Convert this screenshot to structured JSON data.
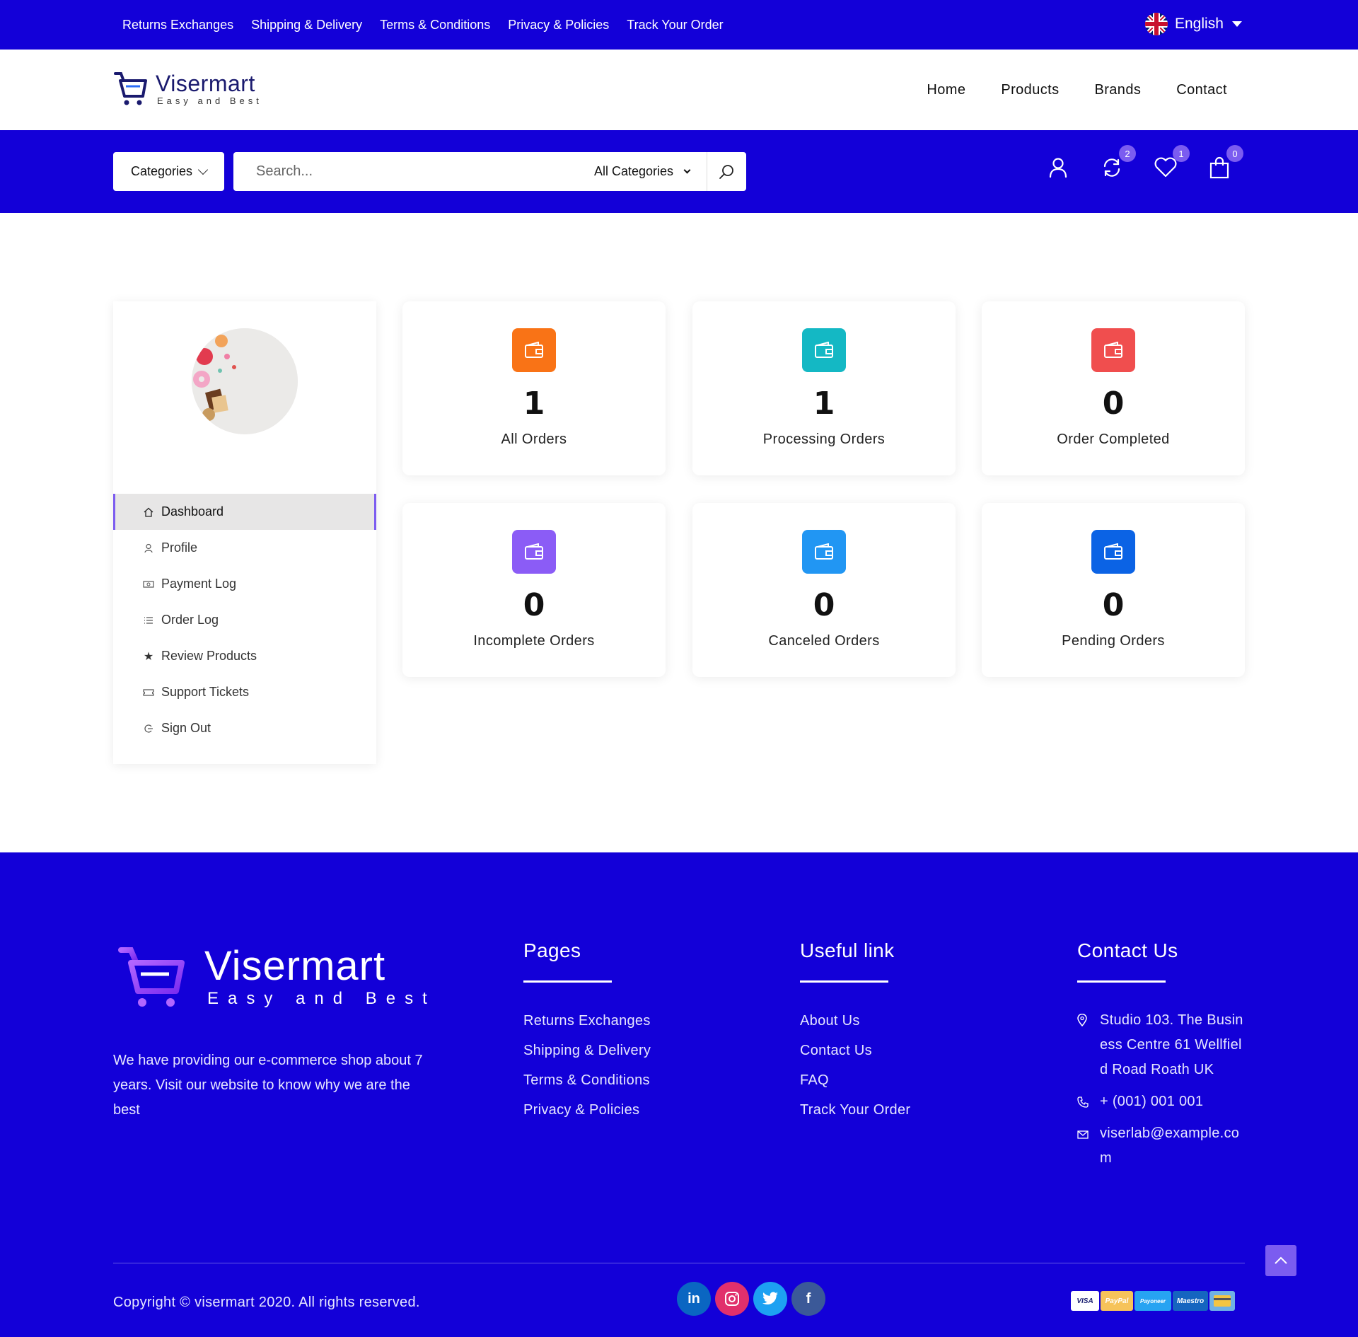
{
  "topbar": {
    "links": [
      "Returns Exchanges",
      "Shipping & Delivery",
      "Terms & Conditions",
      "Privacy & Policies",
      "Track Your Order"
    ],
    "language": "English"
  },
  "header": {
    "logo_brand": "Visermart",
    "logo_tagline": "Easy and Best",
    "nav": [
      "Home",
      "Products",
      "Brands",
      "Contact"
    ]
  },
  "search": {
    "categories_label": "Categories",
    "placeholder": "Search...",
    "all_categories": "All Categories",
    "badges": {
      "compare": "2",
      "wishlist": "1",
      "cart": "0"
    }
  },
  "sidebar": {
    "menu": [
      {
        "label": "Dashboard",
        "icon": "home-icon"
      },
      {
        "label": "Profile",
        "icon": "user-icon"
      },
      {
        "label": "Payment Log",
        "icon": "money-icon"
      },
      {
        "label": "Order Log",
        "icon": "list-icon"
      },
      {
        "label": "Review Products",
        "icon": "star-icon"
      },
      {
        "label": "Support Tickets",
        "icon": "ticket-icon"
      },
      {
        "label": "Sign Out",
        "icon": "signout-icon"
      }
    ]
  },
  "stats": [
    {
      "value": "1",
      "label": "All Orders",
      "color": "#f97316"
    },
    {
      "value": "1",
      "label": "Processing Orders",
      "color": "#14b8c4"
    },
    {
      "value": "0",
      "label": "Order Completed",
      "color": "#f04e4e"
    },
    {
      "value": "0",
      "label": "Incomplete Orders",
      "color": "#8b5cf6"
    },
    {
      "value": "0",
      "label": "Canceled Orders",
      "color": "#2196f3"
    },
    {
      "value": "0",
      "label": "Pending Orders",
      "color": "#0b63e5"
    }
  ],
  "footer": {
    "logo_brand": "Visermart",
    "logo_tagline": "Easy and Best",
    "about": "We have providing our e-commerce shop about 7 years. Visit our website to know why we are the best",
    "pages_title": "Pages",
    "pages": [
      "Returns Exchanges",
      "Shipping & Delivery",
      "Terms & Conditions",
      "Privacy & Policies"
    ],
    "useful_title": "Useful link",
    "useful": [
      "About Us",
      "Contact Us",
      "FAQ",
      "Track Your Order"
    ],
    "contact_title": "Contact Us",
    "address": "Studio 103. The Business Centre 61 Wellfield Road Roath UK",
    "phone": "+ (001) 001 001",
    "email": "viserlab@example.com",
    "copyright": "Copyright © visermart 2020. All rights reserved.",
    "social": [
      "in",
      "ig",
      "tw",
      "f"
    ],
    "payments": [
      "VISA",
      "PayPal",
      "Payoneer",
      "Maestro",
      "card"
    ]
  },
  "colors": {
    "primary": "#1300d8",
    "accent": "#7b5cf0"
  }
}
